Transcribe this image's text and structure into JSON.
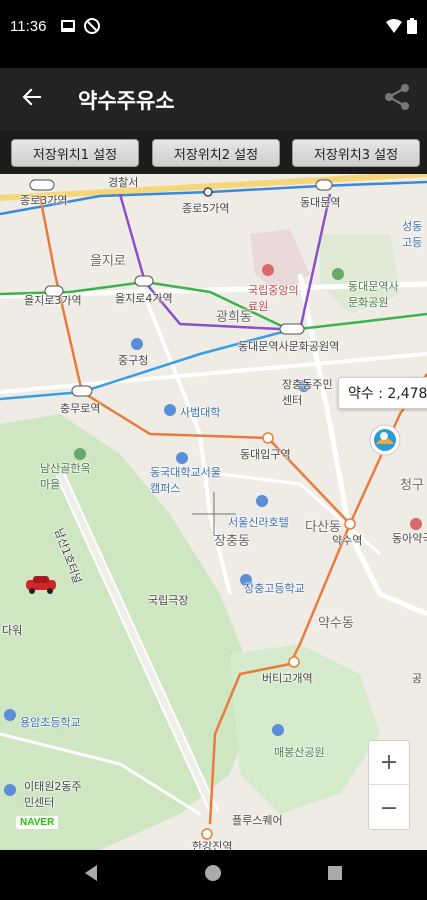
{
  "status_bar": {
    "time": "11:36",
    "icons": [
      "mail-icon",
      "no-disturb-icon",
      "wifi-icon",
      "battery-icon"
    ]
  },
  "app_bar": {
    "title": "약수주유소",
    "back_icon": "arrow-left-icon",
    "share_icon": "share-icon"
  },
  "save_buttons": [
    {
      "label": "저장위치1 설정"
    },
    {
      "label": "저장위치2 설정"
    },
    {
      "label": "저장위치3 설정"
    }
  ],
  "map": {
    "price_label": "약수 : 2,478",
    "zoom_in": "+",
    "zoom_out": "−",
    "logo": "NAVER",
    "labels": [
      {
        "text": "종로3가역"
      },
      {
        "text": "종로5가역"
      },
      {
        "text": "동대문역"
      },
      {
        "text": "을지로"
      },
      {
        "text": "을지로3가역"
      },
      {
        "text": "을지로4가역"
      },
      {
        "text": "국립중앙의료원"
      },
      {
        "text": "동대문역사문화공원"
      },
      {
        "text": "광희동"
      },
      {
        "text": "중구청"
      },
      {
        "text": "동대문역사문화공원역"
      },
      {
        "text": "장충동주민센터"
      },
      {
        "text": "충무로역"
      },
      {
        "text": "사범대학"
      },
      {
        "text": "동대입구역"
      },
      {
        "text": "남산골한옥마을"
      },
      {
        "text": "동국대학교서울캠퍼스"
      },
      {
        "text": "서울신라호텔"
      },
      {
        "text": "다산동"
      },
      {
        "text": "장충동"
      },
      {
        "text": "약수역"
      },
      {
        "text": "청구"
      },
      {
        "text": "동아약국"
      },
      {
        "text": "장충고등학교"
      },
      {
        "text": "국립극장"
      },
      {
        "text": "약수동"
      },
      {
        "text": "버티고개역"
      },
      {
        "text": "용암초등학교"
      },
      {
        "text": "매봉산공원"
      },
      {
        "text": "이태원2동주민센터"
      },
      {
        "text": "플루스퀘어"
      },
      {
        "text": "한강진역"
      },
      {
        "text": "성동"
      },
      {
        "text": "고등"
      },
      {
        "text": "공"
      },
      {
        "text": "다워"
      },
      {
        "text": "경찰서"
      },
      {
        "text": "남산1호터널"
      }
    ]
  },
  "colors": {
    "app_bar": "#232323",
    "line_orange": "#e87c3e",
    "line_green": "#3bb34a",
    "line_purple": "#8b50c8",
    "line_blue": "#3b89d6",
    "park": "#cfe6c3"
  }
}
